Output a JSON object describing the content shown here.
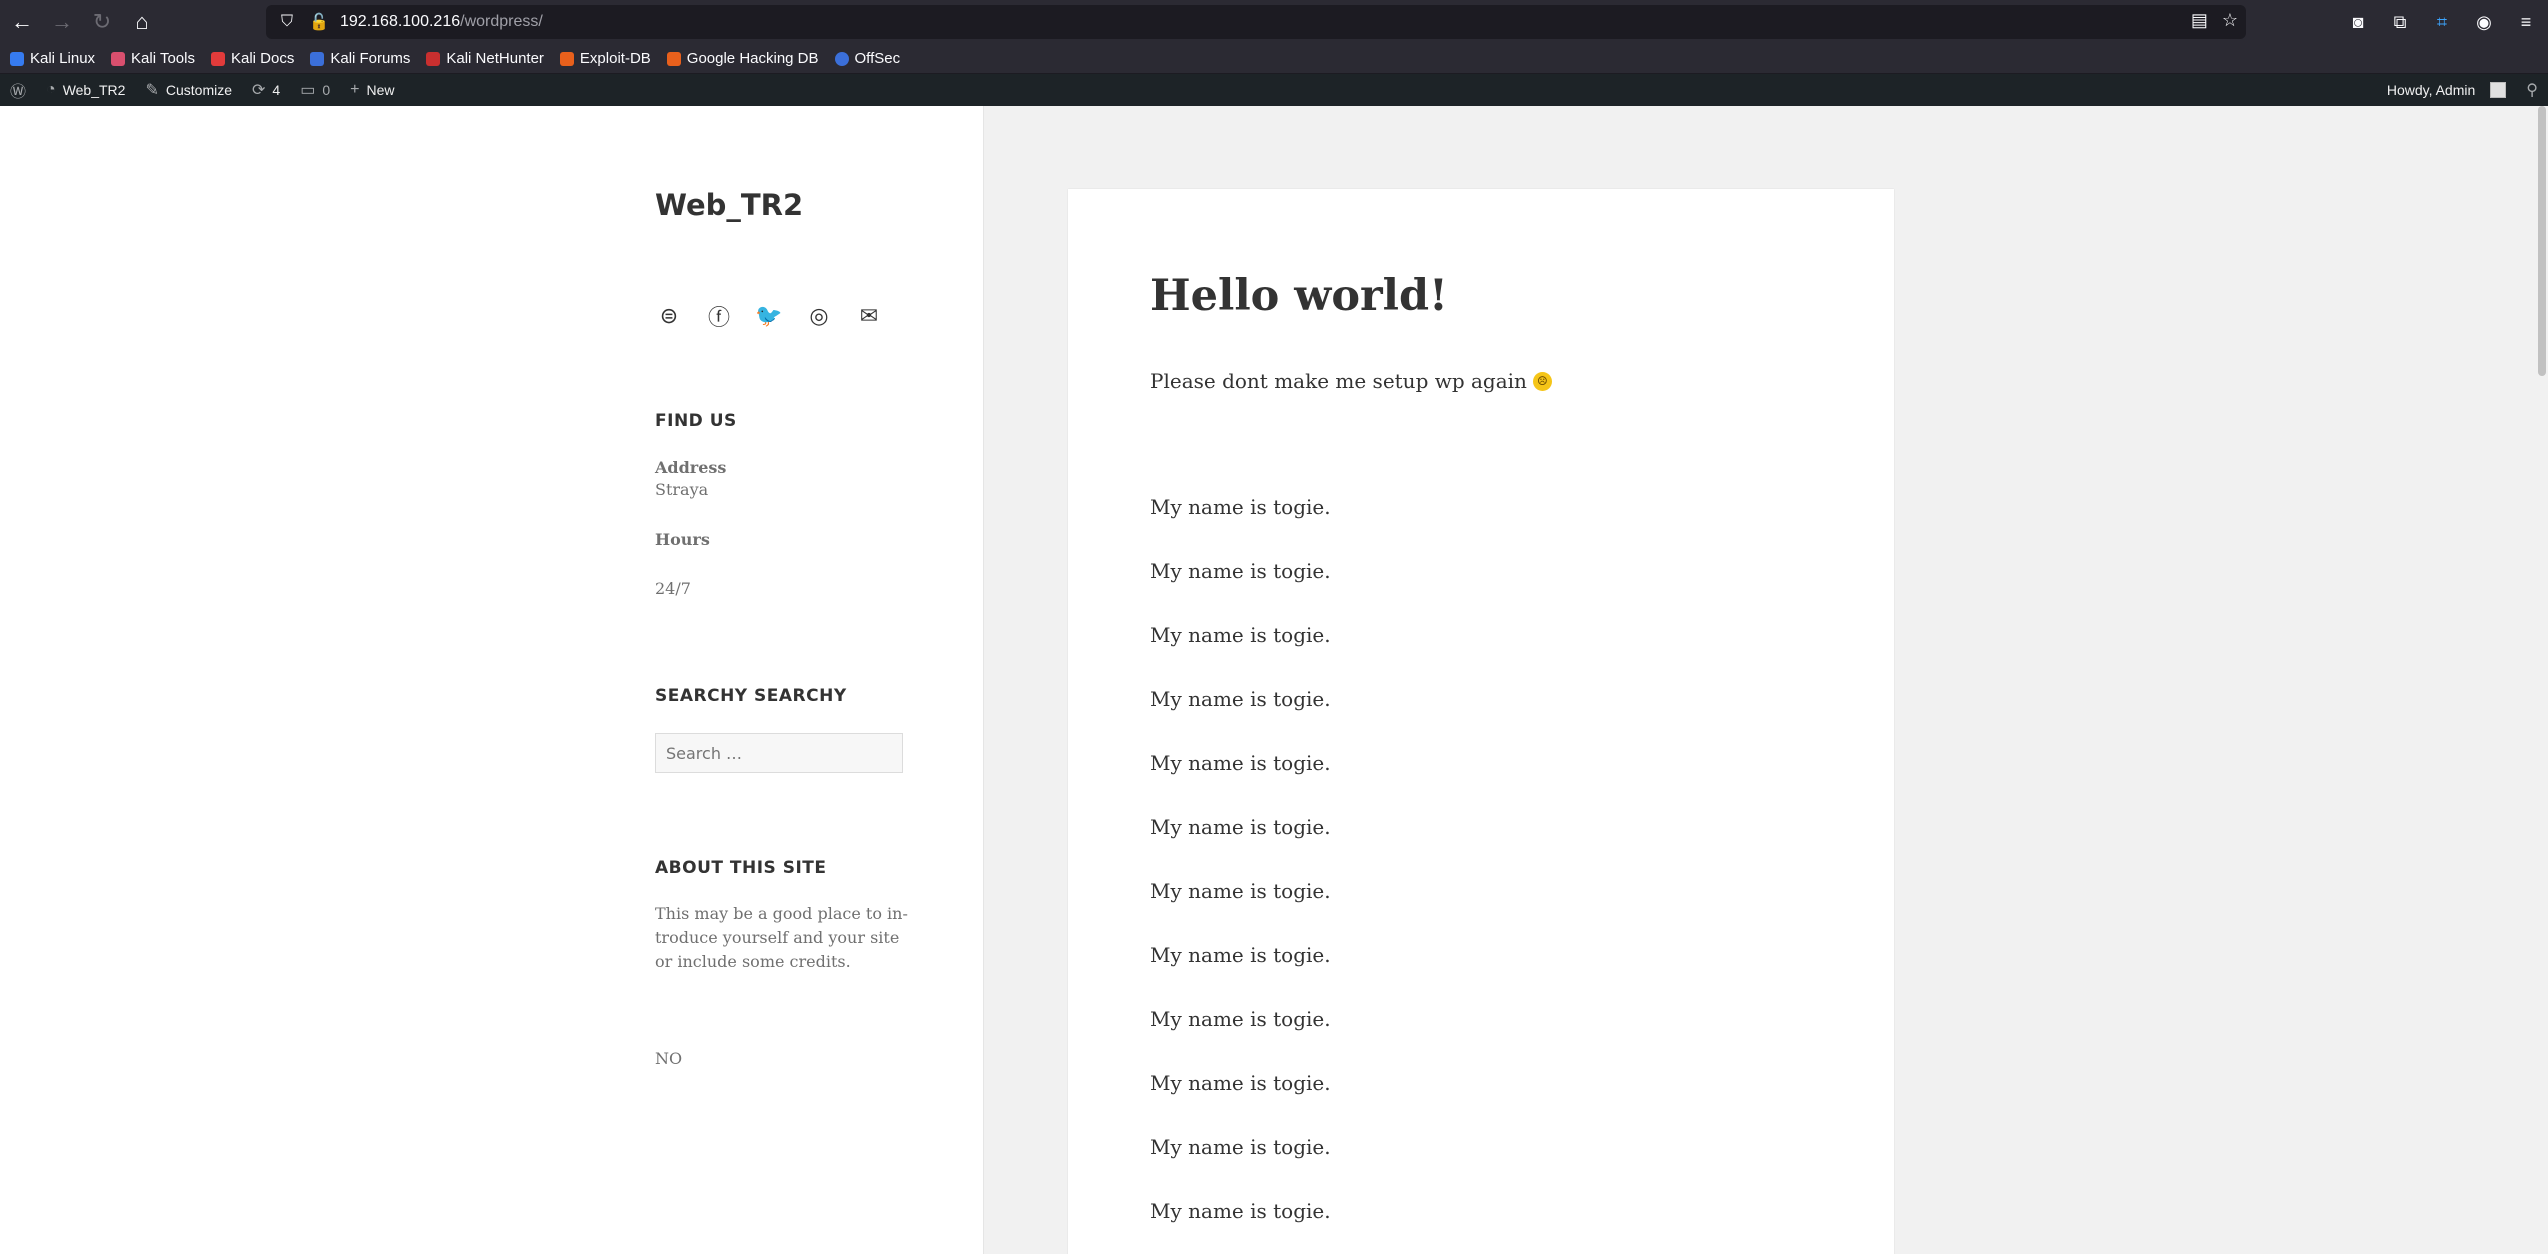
{
  "browser": {
    "url_host": "192.168.100.216",
    "url_path": "/wordpress/",
    "bookmarks": [
      "Kali Linux",
      "Kali Tools",
      "Kali Docs",
      "Kali Forums",
      "Kali NetHunter",
      "Exploit-DB",
      "Google Hacking DB",
      "OffSec"
    ]
  },
  "adminbar": {
    "site_name": "Web_TR2",
    "customize": "Customize",
    "updates_count": "4",
    "comments_count": "0",
    "new_label": "New",
    "howdy": "Howdy, Admin"
  },
  "sidebar": {
    "site_title": "Web_TR2",
    "find_us_title": "FIND US",
    "address_label": "Address",
    "address_value": "Straya",
    "hours_label": "Hours",
    "hours_value": "24/7",
    "search_title": "SEARCHY SEARCHY",
    "search_placeholder": "Search …",
    "about_title": "ABOUT THIS SITE",
    "about_text_1": "This may be a good place to in-",
    "about_text_2": "troduce yourself and your site",
    "about_text_3": "or include some credits.",
    "footer_text": "NO"
  },
  "post": {
    "title": "Hello world!",
    "intro": "Please dont make me setup wp again",
    "lines": [
      "My name is togie.",
      "My name is togie.",
      "My name is togie.",
      "My name is togie.",
      "My name is togie.",
      "My name is togie.",
      "My name is togie.",
      "My name is togie.",
      "My name is togie.",
      "My name is togie.",
      "My name is togie.",
      "My name is togie."
    ]
  }
}
